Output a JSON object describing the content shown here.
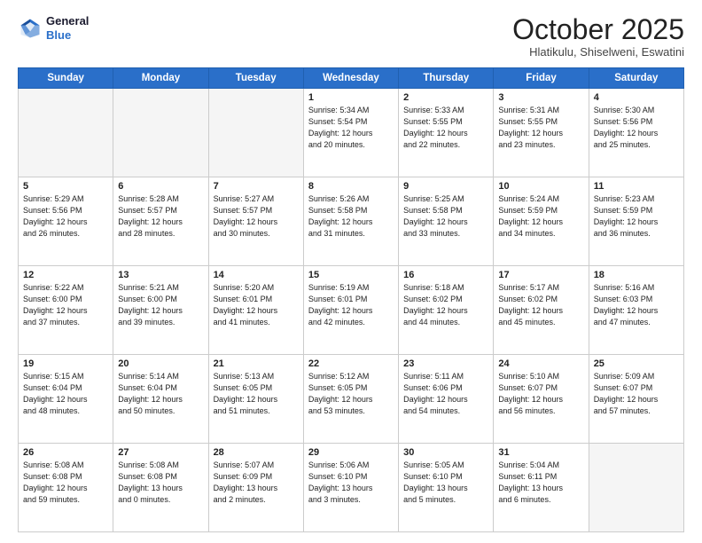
{
  "header": {
    "logo_line1": "General",
    "logo_line2": "Blue",
    "month_title": "October 2025",
    "location": "Hlatikulu, Shiselweni, Eswatini"
  },
  "weekdays": [
    "Sunday",
    "Monday",
    "Tuesday",
    "Wednesday",
    "Thursday",
    "Friday",
    "Saturday"
  ],
  "weeks": [
    [
      {
        "day": "",
        "info": ""
      },
      {
        "day": "",
        "info": ""
      },
      {
        "day": "",
        "info": ""
      },
      {
        "day": "1",
        "info": "Sunrise: 5:34 AM\nSunset: 5:54 PM\nDaylight: 12 hours\nand 20 minutes."
      },
      {
        "day": "2",
        "info": "Sunrise: 5:33 AM\nSunset: 5:55 PM\nDaylight: 12 hours\nand 22 minutes."
      },
      {
        "day": "3",
        "info": "Sunrise: 5:31 AM\nSunset: 5:55 PM\nDaylight: 12 hours\nand 23 minutes."
      },
      {
        "day": "4",
        "info": "Sunrise: 5:30 AM\nSunset: 5:56 PM\nDaylight: 12 hours\nand 25 minutes."
      }
    ],
    [
      {
        "day": "5",
        "info": "Sunrise: 5:29 AM\nSunset: 5:56 PM\nDaylight: 12 hours\nand 26 minutes."
      },
      {
        "day": "6",
        "info": "Sunrise: 5:28 AM\nSunset: 5:57 PM\nDaylight: 12 hours\nand 28 minutes."
      },
      {
        "day": "7",
        "info": "Sunrise: 5:27 AM\nSunset: 5:57 PM\nDaylight: 12 hours\nand 30 minutes."
      },
      {
        "day": "8",
        "info": "Sunrise: 5:26 AM\nSunset: 5:58 PM\nDaylight: 12 hours\nand 31 minutes."
      },
      {
        "day": "9",
        "info": "Sunrise: 5:25 AM\nSunset: 5:58 PM\nDaylight: 12 hours\nand 33 minutes."
      },
      {
        "day": "10",
        "info": "Sunrise: 5:24 AM\nSunset: 5:59 PM\nDaylight: 12 hours\nand 34 minutes."
      },
      {
        "day": "11",
        "info": "Sunrise: 5:23 AM\nSunset: 5:59 PM\nDaylight: 12 hours\nand 36 minutes."
      }
    ],
    [
      {
        "day": "12",
        "info": "Sunrise: 5:22 AM\nSunset: 6:00 PM\nDaylight: 12 hours\nand 37 minutes."
      },
      {
        "day": "13",
        "info": "Sunrise: 5:21 AM\nSunset: 6:00 PM\nDaylight: 12 hours\nand 39 minutes."
      },
      {
        "day": "14",
        "info": "Sunrise: 5:20 AM\nSunset: 6:01 PM\nDaylight: 12 hours\nand 41 minutes."
      },
      {
        "day": "15",
        "info": "Sunrise: 5:19 AM\nSunset: 6:01 PM\nDaylight: 12 hours\nand 42 minutes."
      },
      {
        "day": "16",
        "info": "Sunrise: 5:18 AM\nSunset: 6:02 PM\nDaylight: 12 hours\nand 44 minutes."
      },
      {
        "day": "17",
        "info": "Sunrise: 5:17 AM\nSunset: 6:02 PM\nDaylight: 12 hours\nand 45 minutes."
      },
      {
        "day": "18",
        "info": "Sunrise: 5:16 AM\nSunset: 6:03 PM\nDaylight: 12 hours\nand 47 minutes."
      }
    ],
    [
      {
        "day": "19",
        "info": "Sunrise: 5:15 AM\nSunset: 6:04 PM\nDaylight: 12 hours\nand 48 minutes."
      },
      {
        "day": "20",
        "info": "Sunrise: 5:14 AM\nSunset: 6:04 PM\nDaylight: 12 hours\nand 50 minutes."
      },
      {
        "day": "21",
        "info": "Sunrise: 5:13 AM\nSunset: 6:05 PM\nDaylight: 12 hours\nand 51 minutes."
      },
      {
        "day": "22",
        "info": "Sunrise: 5:12 AM\nSunset: 6:05 PM\nDaylight: 12 hours\nand 53 minutes."
      },
      {
        "day": "23",
        "info": "Sunrise: 5:11 AM\nSunset: 6:06 PM\nDaylight: 12 hours\nand 54 minutes."
      },
      {
        "day": "24",
        "info": "Sunrise: 5:10 AM\nSunset: 6:07 PM\nDaylight: 12 hours\nand 56 minutes."
      },
      {
        "day": "25",
        "info": "Sunrise: 5:09 AM\nSunset: 6:07 PM\nDaylight: 12 hours\nand 57 minutes."
      }
    ],
    [
      {
        "day": "26",
        "info": "Sunrise: 5:08 AM\nSunset: 6:08 PM\nDaylight: 12 hours\nand 59 minutes."
      },
      {
        "day": "27",
        "info": "Sunrise: 5:08 AM\nSunset: 6:08 PM\nDaylight: 13 hours\nand 0 minutes."
      },
      {
        "day": "28",
        "info": "Sunrise: 5:07 AM\nSunset: 6:09 PM\nDaylight: 13 hours\nand 2 minutes."
      },
      {
        "day": "29",
        "info": "Sunrise: 5:06 AM\nSunset: 6:10 PM\nDaylight: 13 hours\nand 3 minutes."
      },
      {
        "day": "30",
        "info": "Sunrise: 5:05 AM\nSunset: 6:10 PM\nDaylight: 13 hours\nand 5 minutes."
      },
      {
        "day": "31",
        "info": "Sunrise: 5:04 AM\nSunset: 6:11 PM\nDaylight: 13 hours\nand 6 minutes."
      },
      {
        "day": "",
        "info": ""
      }
    ]
  ]
}
